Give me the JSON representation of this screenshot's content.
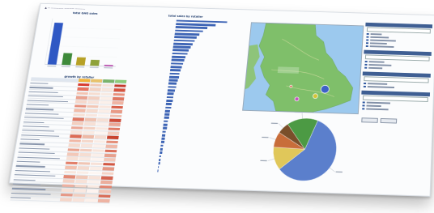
{
  "header": {
    "breadcrumb": "▲ — ————— ———— ————"
  },
  "bar_chart": {
    "title": "total GHG sales",
    "colors": [
      "#2f58c4",
      "#3e8a3a",
      "#b7a126",
      "#8fa23a",
      "#b43fa7"
    ],
    "chart_data": {
      "type": "bar",
      "categories": [
        "",
        "",
        "",
        "",
        ""
      ],
      "values": [
        100,
        28,
        19,
        14,
        3
      ],
      "ylim": [
        0,
        110
      ]
    }
  },
  "region_table": {
    "title": "growth by retailer",
    "columns": [
      "",
      "",
      "",
      ""
    ],
    "rows": [
      {
        "label": "",
        "heat": [
          "#d73a2e",
          "#f0c9b5",
          "#f5e2d8",
          "#c43b2d"
        ]
      },
      {
        "label": "",
        "heat": [
          "#e8735f",
          "#f4d3c3",
          "#f7e6dc",
          "#d6543f"
        ]
      },
      {
        "label": "",
        "heat": [
          "#f3c4b2",
          "#f6ddd0",
          "#f8eae2",
          "#e8917d"
        ]
      },
      {
        "label": "",
        "heat": [
          "#eaa28f",
          "#f3d0c1",
          "#fbefe8",
          "#e07762"
        ]
      },
      {
        "label": "",
        "heat": [
          "#f6d8cb",
          "#f8e3da",
          "#fbf0ea",
          "#f0b4a3"
        ]
      },
      {
        "label": "",
        "heat": [
          "#e8917d",
          "#f2c7b6",
          "#f9e6dd",
          "#d8604a"
        ]
      },
      {
        "label": "",
        "heat": [
          "#f2bca9",
          "#f6dccf",
          "#fbeee7",
          "#e99a86"
        ]
      },
      {
        "label": "",
        "heat": [
          "#f7dfd3",
          "#f8e6de",
          "#fcf2ed",
          "#f1bfb0"
        ]
      },
      {
        "label": "",
        "heat": [
          "#e07762",
          "#f0c2b0",
          "#f6dfd4",
          "#cf4d3a"
        ]
      },
      {
        "label": "",
        "heat": [
          "#f4cfbf",
          "#f7e0d5",
          "#fbf0eb",
          "#eba897"
        ]
      },
      {
        "label": "",
        "heat": [
          "#eba897",
          "#f3d1c2",
          "#f9e8e0",
          "#df7b66"
        ]
      },
      {
        "label": "",
        "heat": [
          "#f8e4db",
          "#f9ebe4",
          "#fdf5f1",
          "#f4cdbf"
        ]
      },
      {
        "label": "",
        "heat": [
          "#dd6b55",
          "#eeb9a6",
          "#f5dcd1",
          "#c9432f"
        ]
      },
      {
        "label": "",
        "heat": [
          "#f1b7a5",
          "#f5d7ca",
          "#faece5",
          "#e48e79"
        ]
      },
      {
        "label": "",
        "heat": [
          "#f6dacd",
          "#f8e5dc",
          "#fcf1ec",
          "#efb8a8"
        ]
      },
      {
        "label": "",
        "heat": [
          "#e9a08c",
          "#f2cbbc",
          "#f8e4da",
          "#db6f5a"
        ]
      },
      {
        "label": "",
        "heat": [
          "#f3c8b8",
          "#f6ddd1",
          "#fbefe9",
          "#e7a08d"
        ]
      },
      {
        "label": "",
        "heat": [
          "#f7e1d6",
          "#f9e9e1",
          "#fdf4f0",
          "#f2c6b7"
        ]
      },
      {
        "label": "",
        "heat": [
          "#e27f6a",
          "#f0c5b4",
          "#f7e1d7",
          "#d25843"
        ]
      },
      {
        "label": "",
        "heat": [
          "#f2c0ae",
          "#f5dace",
          "#faede6",
          "#e59783"
        ]
      },
      {
        "label": "",
        "heat": [
          "#f8e6dd",
          "#faede6",
          "#fdf6f2",
          "#f5d3c6"
        ]
      },
      {
        "label": "",
        "heat": [
          "#e38a75",
          "#f1c8b7",
          "#f7e2d8",
          "#d56450"
        ]
      },
      {
        "label": "",
        "heat": [
          "#f4d2c4",
          "#f7e2d8",
          "#fbf1ec",
          "#ecae9c"
        ]
      },
      {
        "label": "",
        "heat": [
          "#eeb0a0",
          "#f4d4c6",
          "#f9e9e1",
          "#e18571"
        ]
      },
      {
        "label": "",
        "heat": [
          "#f7e0d5",
          "#f9e8e0",
          "#fdf3ef",
          "#f2c3b4"
        ]
      },
      {
        "label": "",
        "heat": [
          "#e69886",
          "#f2cebf",
          "#f8e5dc",
          "#d96b56"
        ]
      },
      {
        "label": "",
        "heat": [
          "#f5d6c9",
          "#f8e3da",
          "#fcf0ea",
          "#eeb3a2"
        ]
      }
    ]
  },
  "hbar_chart": {
    "title": "total sales by retailer",
    "color": "#3d64b5",
    "chart_data": {
      "type": "bar",
      "categories": [
        "",
        "",
        "",
        "",
        "",
        "",
        "",
        "",
        "",
        "",
        "",
        "",
        "",
        "",
        "",
        "",
        "",
        "",
        "",
        "",
        "",
        "",
        "",
        "",
        "",
        "",
        "",
        "",
        "",
        "",
        "",
        "",
        "",
        "",
        "",
        "",
        "",
        "",
        "",
        "",
        "",
        "",
        "",
        "",
        "",
        ""
      ],
      "values": [
        100,
        78,
        62,
        55,
        49,
        44,
        40,
        37,
        34,
        31,
        29,
        27,
        25,
        23,
        22,
        20,
        19,
        18,
        17,
        16,
        15,
        14,
        13,
        12.5,
        12,
        11,
        10.5,
        10,
        9.5,
        9,
        8.5,
        8,
        7.5,
        7,
        6.5,
        6,
        5.5,
        5,
        4.5,
        4,
        3.5,
        3,
        2.5,
        2,
        1.5
      ],
      "ylim": [
        0,
        100
      ]
    }
  },
  "map": {
    "title": "",
    "region_label": "",
    "land_color": "#7fbf6a",
    "sea_color": "#9cc9ee",
    "bubbles": [
      {
        "name": "",
        "color": "#3a5ccc",
        "cx_frac": 0.7,
        "cy_frac": 0.74,
        "r": 5
      },
      {
        "name": "",
        "color": "#d9c534",
        "cx_frac": 0.62,
        "cy_frac": 0.82,
        "r": 3
      },
      {
        "name": "",
        "color": "#c94fc6",
        "cx_frac": 0.46,
        "cy_frac": 0.86,
        "r": 2.5
      },
      {
        "name": "",
        "color": "#e04a3b",
        "cx_frac": 0.4,
        "cy_frac": 0.72,
        "r": 1.5
      }
    ]
  },
  "pie_chart": {
    "labels": [
      "",
      "",
      "",
      "",
      ""
    ],
    "chart_data": {
      "type": "pie",
      "values": [
        58,
        12,
        8,
        6,
        16
      ],
      "colors": [
        "#5b7fcc",
        "#e0c75a",
        "#c86d3a",
        "#7a4f2a",
        "#4c9a44"
      ]
    }
  },
  "sidebar": {
    "sections": [
      {
        "title": "",
        "items": [
          "",
          "",
          "",
          "",
          ""
        ]
      },
      {
        "title": "",
        "items": [
          "",
          "",
          ""
        ]
      },
      {
        "title": "",
        "items": [
          "",
          ""
        ]
      },
      {
        "title": "",
        "items": [
          "",
          "",
          ""
        ]
      }
    ],
    "buttons": [
      "",
      ""
    ]
  }
}
